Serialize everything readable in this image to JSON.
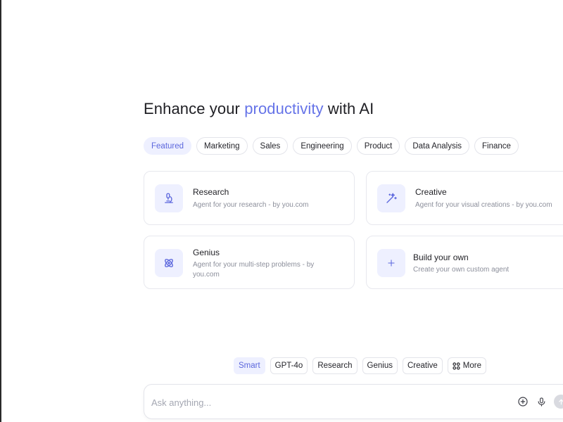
{
  "headline": {
    "before": "Enhance your ",
    "accent": "productivity",
    "after": " with AI"
  },
  "categories": [
    "Featured",
    "Marketing",
    "Sales",
    "Engineering",
    "Product",
    "Data Analysis",
    "Finance"
  ],
  "active_category": "Featured",
  "agents": [
    {
      "title": "Research",
      "description": "Agent for your research - by you.com",
      "icon": "microscope-icon"
    },
    {
      "title": "Creative",
      "description": "Agent for your visual creations - by you.com",
      "icon": "magic-wand-icon"
    },
    {
      "title": "Genius",
      "description": "Agent for your multi-step problems - by you.com",
      "icon": "atom-icon"
    },
    {
      "title": "Build your own",
      "description": "Create your own custom agent",
      "icon": "plus-icon"
    }
  ],
  "modes": [
    "Smart",
    "GPT-4o",
    "Research",
    "Genius",
    "Creative",
    "More"
  ],
  "active_mode": "Smart",
  "ask": {
    "placeholder": "Ask anything..."
  },
  "colors": {
    "accent": "#6674e8",
    "chip_active_bg": "#eef0ff",
    "border": "#e3e4ea",
    "muted_text": "#8c8f9b"
  }
}
